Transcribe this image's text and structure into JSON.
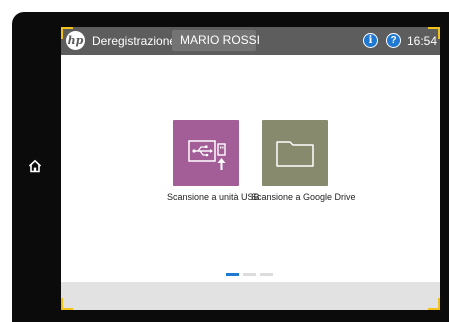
{
  "device": {
    "home_icon": "home-icon"
  },
  "header": {
    "logo_text": "hp",
    "signout_label": "Deregistrazione",
    "user_name": "MARIO ROSSI",
    "info_icon": "info-icon",
    "info_glyph": "i",
    "help_icon": "help-icon",
    "help_glyph": "?",
    "time": "16:54"
  },
  "apps": [
    {
      "label": "Scansione a unità USB",
      "icon": "usb-icon",
      "color": "#a35d97"
    },
    {
      "label": "Scansione a Google Drive",
      "icon": "folder-icon",
      "color": "#878a6c"
    }
  ],
  "pagination": {
    "pages": 3,
    "current": 1
  },
  "colors": {
    "accent_frame": "#f2c21b",
    "header_bg": "#5d5d5d",
    "active_dot": "#1f78d1"
  }
}
